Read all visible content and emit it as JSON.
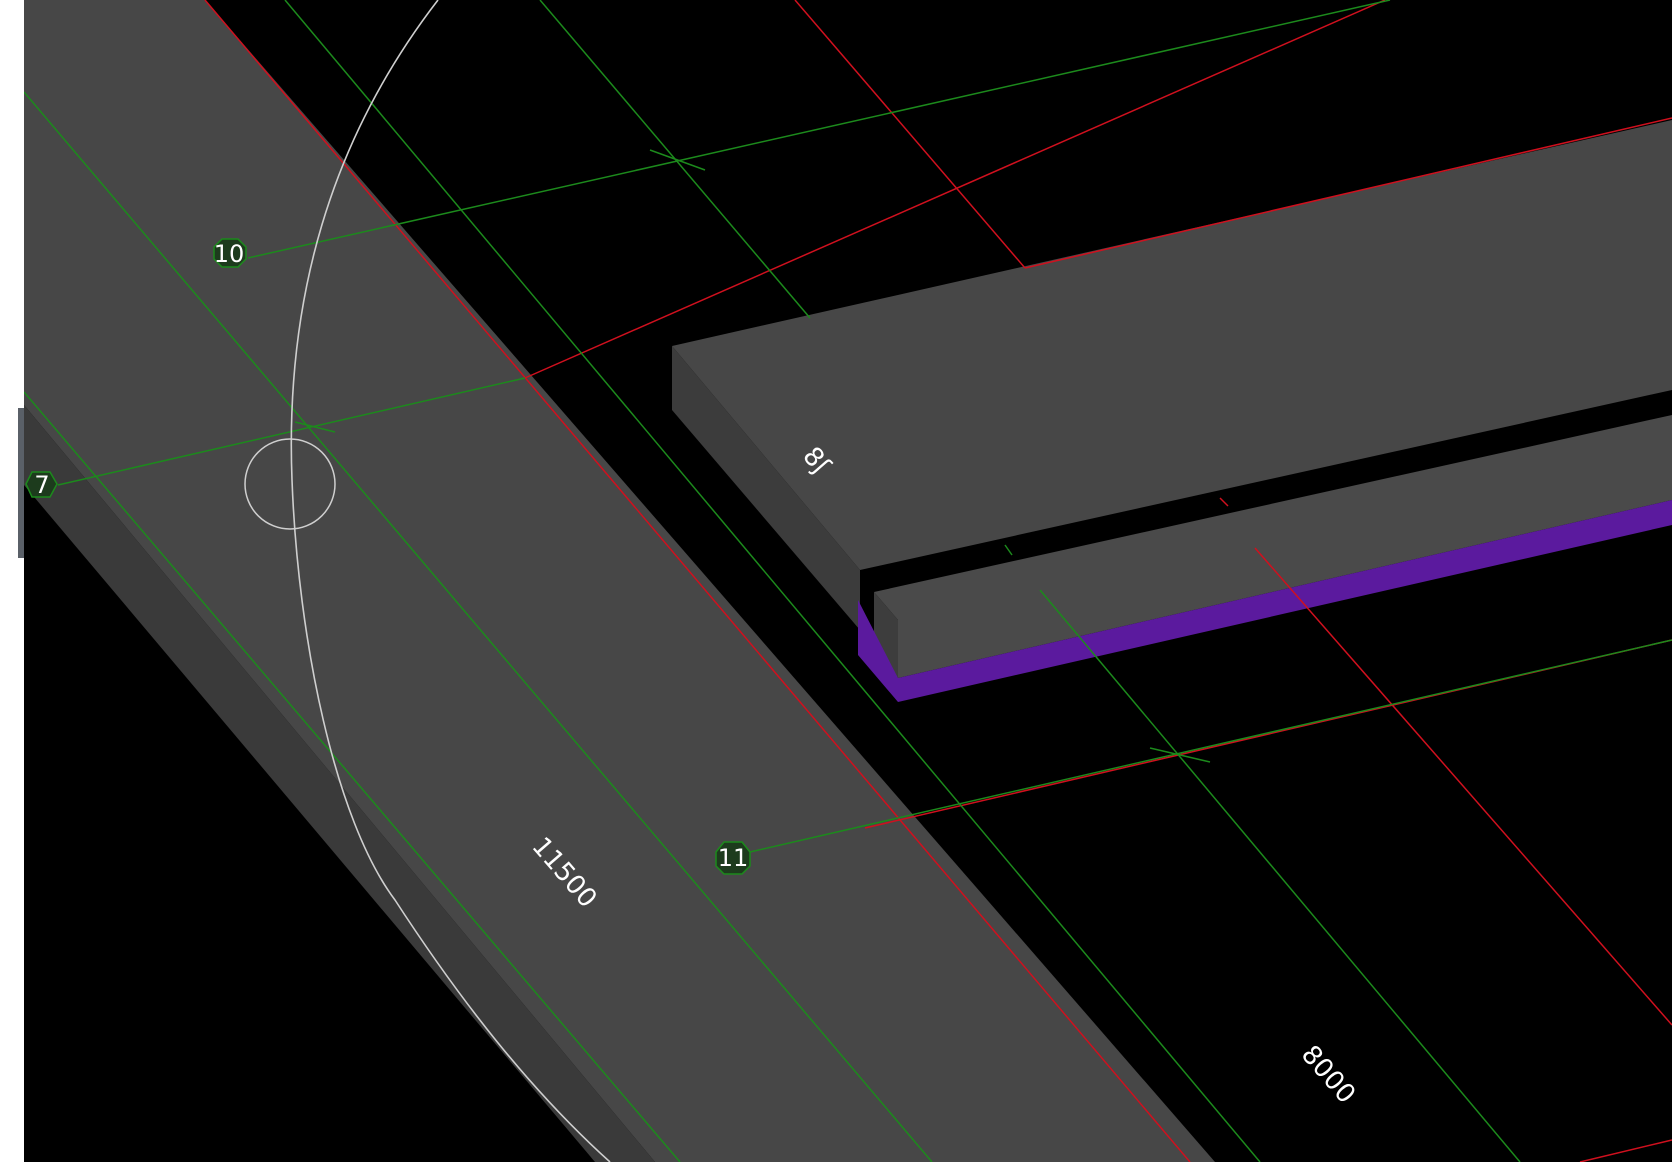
{
  "viewport": {
    "name": "3D model view",
    "background": "#000000"
  },
  "grid_bubbles": [
    {
      "label": "10"
    },
    {
      "label": "7"
    },
    {
      "label": "11"
    }
  ],
  "dimensions": [
    {
      "label": "11500"
    },
    {
      "label": "8000"
    },
    {
      "label": "8ʃ"
    }
  ],
  "colors": {
    "slab_top": "#474747",
    "slab_side": "#3a3a3a",
    "slab_purple": "#5b1a9e",
    "grid_green": "#1c8a1c",
    "grid_red": "#d0101e",
    "curve": "#cfcfcf"
  }
}
